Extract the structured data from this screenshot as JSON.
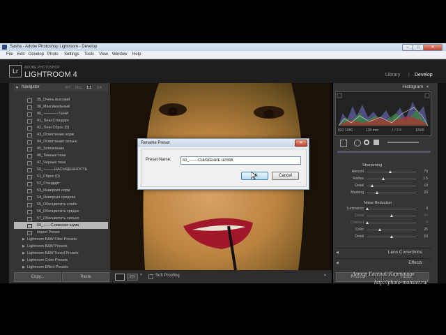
{
  "window": {
    "title": "Sasha - Adobe Photoshop Lightroom - Develop"
  },
  "menu": [
    "File",
    "Edit",
    "Develop",
    "Photo",
    "Settings",
    "Tools",
    "View",
    "Window",
    "Help"
  ],
  "header": {
    "brand": "ADOBE PHOTOSHOP",
    "product": "LIGHTROOM 4",
    "modules": [
      "Library",
      "Develop"
    ]
  },
  "left_panel": {
    "navigator": {
      "title": "Navigator",
      "zoom_options": [
        "FIT",
        "FILL",
        "1:1",
        "1:4"
      ]
    },
    "presets": [
      {
        "label": "35_Очень высокий",
        "type": "preset"
      },
      {
        "label": "36_Максимальный",
        "type": "preset"
      },
      {
        "label": "40_————ТЕНИ",
        "type": "preset"
      },
      {
        "label": "41_Тени Стандарт",
        "type": "preset"
      },
      {
        "label": "42_Тени Сброс (0)",
        "type": "preset"
      },
      {
        "label": "43_Осветление норм",
        "type": "preset"
      },
      {
        "label": "44_Осветление сильно",
        "type": "preset"
      },
      {
        "label": "45_Затемнение",
        "type": "preset"
      },
      {
        "label": "46_Темные тени",
        "type": "preset"
      },
      {
        "label": "47_Черные тени",
        "type": "preset"
      },
      {
        "label": "50_———НАСЫЩЕННОСТЬ",
        "type": "preset"
      },
      {
        "label": "51_Сброс (0)",
        "type": "preset"
      },
      {
        "label": "52_Стандарт",
        "type": "preset"
      },
      {
        "label": "53_Инверсия норм",
        "type": "preset"
      },
      {
        "label": "54_Инверсия средняя",
        "type": "preset"
      },
      {
        "label": "55_Обесцветить слабо",
        "type": "preset"
      },
      {
        "label": "56_Обесцветить средне",
        "type": "preset"
      },
      {
        "label": "57_Обесцветить сильно",
        "type": "preset"
      },
      {
        "label": "60_——Снижение шума",
        "type": "preset",
        "selected": true
      },
      {
        "label": "Import Preset",
        "type": "preset"
      },
      {
        "label": "Lightroom B&W Filter Presets",
        "type": "folder"
      },
      {
        "label": "Lightroom B&W Presets",
        "type": "folder"
      },
      {
        "label": "Lightroom B&W Toned Presets",
        "type": "folder"
      },
      {
        "label": "Lightroom Color Presets",
        "type": "folder"
      },
      {
        "label": "Lightroom Effect Presets",
        "type": "folder"
      }
    ],
    "copy_label": "Copy...",
    "paste_label": "Paste"
  },
  "toolbar": {
    "soft_proofing": "Soft Proofing"
  },
  "right_panel": {
    "histogram_title": "Histogram",
    "exif": [
      "ISO 1000",
      "135 mm",
      "ƒ / 2.0",
      "1/500"
    ],
    "sharpening": {
      "title": "Sharpening",
      "sliders": [
        {
          "label": "Amount",
          "value": "70",
          "pos": 0.47
        },
        {
          "label": "Radius",
          "value": "1,5",
          "pos": 0.33
        },
        {
          "label": "Detail",
          "value": "10",
          "pos": 0.1
        },
        {
          "label": "Masking",
          "value": "20",
          "pos": 0.2
        }
      ]
    },
    "noise_reduction": {
      "title": "Noise Reduction",
      "sliders": [
        {
          "label": "Luminance",
          "value": "0",
          "pos": 0.0
        },
        {
          "label": "Detail",
          "value": "50",
          "pos": 0.5,
          "dim": true
        },
        {
          "label": "Contrast",
          "value": "0",
          "pos": 0.0,
          "dim": true
        },
        {
          "label": "Color",
          "value": "25",
          "pos": 0.25
        },
        {
          "label": "Detail",
          "value": "50",
          "pos": 0.5
        }
      ]
    },
    "sections": [
      "Lens Corrections",
      "Effects"
    ],
    "previous_label": "Previous",
    "reset_label": "Reset"
  },
  "dialog": {
    "title": "Rename Preset",
    "field_label": "Preset Name:",
    "field_value": "60_-------СНИЖЕНИЕ ШУМА",
    "ok_label": "OK",
    "cancel_label": "Cancel"
  },
  "watermark": {
    "line1": "Автор Евгений Карташов",
    "line2": "http://photo-monster.ru/"
  }
}
